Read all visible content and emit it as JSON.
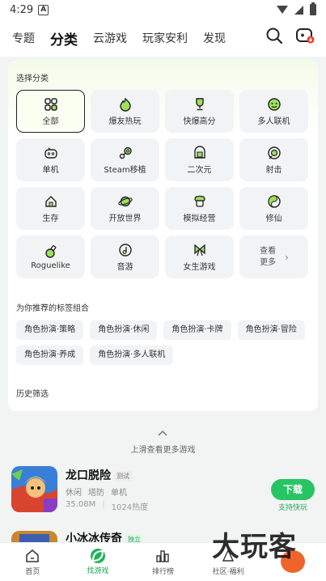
{
  "status_bar": {
    "time": "4:29",
    "app_badge": "A"
  },
  "top_nav": {
    "tabs": [
      "专题",
      "分类",
      "云游戏",
      "玩家安利",
      "发现"
    ],
    "active_index": 1,
    "accent": "#3cd37a"
  },
  "category_section": {
    "title": "选择分类",
    "items": [
      {
        "label": "全部",
        "icon": "grid-icon",
        "active": true
      },
      {
        "label": "爆友热玩",
        "icon": "fire-icon"
      },
      {
        "label": "快爆高分",
        "icon": "trophy-icon"
      },
      {
        "label": "多人联机",
        "icon": "multiplayer-icon"
      },
      {
        "label": "单机",
        "icon": "gamepad-icon"
      },
      {
        "label": "Steam移植",
        "icon": "steam-icon"
      },
      {
        "label": "二次元",
        "icon": "anime-icon"
      },
      {
        "label": "射击",
        "icon": "target-icon"
      },
      {
        "label": "生存",
        "icon": "house-icon"
      },
      {
        "label": "开放世界",
        "icon": "planet-icon"
      },
      {
        "label": "模拟经营",
        "icon": "chef-icon"
      },
      {
        "label": "修仙",
        "icon": "yinyang-icon"
      },
      {
        "label": "Roguelike",
        "icon": "potion-icon"
      },
      {
        "label": "音游",
        "icon": "music-icon"
      },
      {
        "label": "女生游戏",
        "icon": "bow-icon"
      }
    ],
    "more_label_line1": "查看",
    "more_label_line2": "更多"
  },
  "recommend_section": {
    "title": "为你推荐的标签组合",
    "tags": [
      "角色扮演·策略",
      "角色扮演·休闲",
      "角色扮演·卡牌",
      "角色扮演·冒险",
      "角色扮演·养成",
      "角色扮演·多人联机"
    ]
  },
  "history_label": "历史筛选",
  "scroll_hint": "上滑查看更多游戏",
  "games": [
    {
      "title": "龙口脱险",
      "badge": "测试",
      "tags": [
        "休闲",
        "塔防",
        "单机"
      ],
      "size": "35.08M",
      "heat": "1024热度",
      "button": "下载",
      "button_sub": "支持快玩"
    },
    {
      "title": "小冰冰传奇",
      "badge": "独立"
    }
  ],
  "bottom_nav": {
    "items": [
      "首页",
      "找游戏",
      "排行榜",
      "社区·福利",
      ""
    ],
    "active_index": 1
  },
  "watermark": "大玩客"
}
